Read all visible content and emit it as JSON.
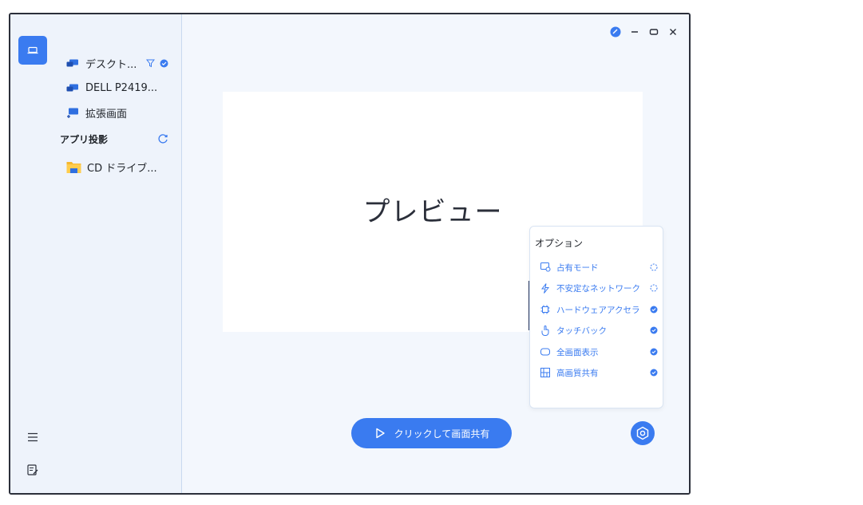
{
  "sidebar": {
    "devices": [
      {
        "label": "デスクト..."
      },
      {
        "label": "DELL P2419..."
      },
      {
        "label": "拡張画面"
      }
    ],
    "app_section_title": "アプリ投影",
    "apps": [
      {
        "label": "CD ドライブ..."
      }
    ]
  },
  "preview": {
    "label": "プレビュー"
  },
  "options": {
    "title": "オプション",
    "items": [
      {
        "label": "占有モード",
        "state": "off"
      },
      {
        "label": "不安定なネットワーク",
        "state": "off"
      },
      {
        "label": "ハードウェアアクセラ",
        "state": "on"
      },
      {
        "label": "タッチバック",
        "state": "on"
      },
      {
        "label": "全画面表示",
        "state": "on"
      },
      {
        "label": "高画質共有",
        "state": "on"
      }
    ]
  },
  "share_button": {
    "label": "クリックして画面共有"
  },
  "colors": {
    "accent": "#3a7bf0",
    "text": "#1f2329",
    "panel": "#eef3fb"
  }
}
